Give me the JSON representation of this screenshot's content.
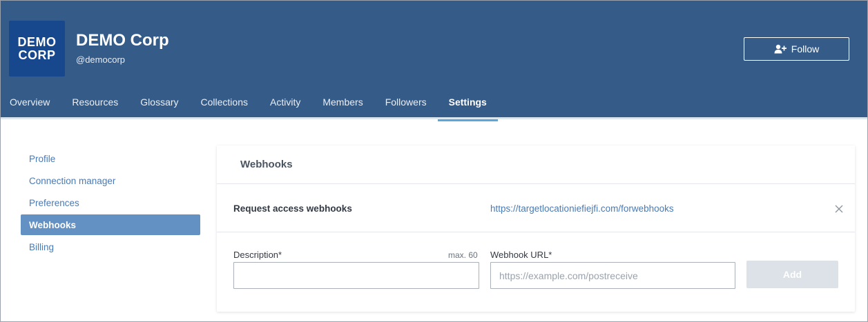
{
  "org": {
    "logo_line1": "DEMO",
    "logo_line2": "CORP",
    "name": "DEMO Corp",
    "handle": "@democorp",
    "follow_label": "Follow"
  },
  "tabs": [
    {
      "label": "Overview"
    },
    {
      "label": "Resources"
    },
    {
      "label": "Glossary"
    },
    {
      "label": "Collections"
    },
    {
      "label": "Activity"
    },
    {
      "label": "Members"
    },
    {
      "label": "Followers"
    },
    {
      "label": "Settings",
      "active": true
    }
  ],
  "sidebar": {
    "items": [
      {
        "label": "Profile"
      },
      {
        "label": "Connection manager"
      },
      {
        "label": "Preferences"
      },
      {
        "label": "Webhooks",
        "active": true
      },
      {
        "label": "Billing"
      }
    ]
  },
  "webhooks": {
    "title": "Webhooks",
    "existing": [
      {
        "description": "Request access webhooks",
        "url": "https://targetlocationiefiejfi.com/forwebhooks"
      }
    ],
    "form": {
      "description_label": "Description*",
      "description_max": "max. 60",
      "description_value": "",
      "url_label": "Webhook URL*",
      "url_placeholder": "https://example.com/postreceive",
      "url_value": "",
      "add_label": "Add"
    }
  },
  "icons": {
    "follow": "user-plus-icon",
    "remove": "close-icon"
  },
  "colors": {
    "header_bg": "#355b89",
    "logo_bg": "#17478d",
    "accent_tab_underline": "#5aa7d8",
    "sidebar_active": "#6391c3",
    "link": "#4a7ab3",
    "button_disabled": "#dde2e8"
  }
}
